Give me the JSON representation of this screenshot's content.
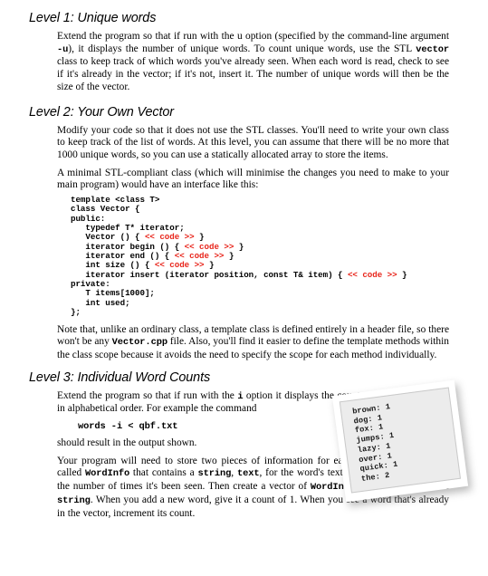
{
  "document": {
    "sections": [
      {
        "id": "level1",
        "heading": "Level 1: Unique words",
        "paragraphs": [
          "Extend the program so that if run with the |b:u| option (specified by the command-line argument |m:-u|), it displays the number of unique words.  To count unique words, use the STL |m:vector| class to keep track of which words you've already seen.  When each word is read, check to see if it's already in the vector; if it's not, insert it.  The number of unique words will then be the size of the vector."
        ]
      },
      {
        "id": "level2",
        "heading": "Level 2: Your Own Vector",
        "paragraphs": [
          "Modify your code so that it does not use the STL classes.  You'll need to write your own class to keep track of the list of words.  At this level, you can assume that there will be no more that 1000 unique words, so you can use a statically allocated array to store the items.",
          "A minimal STL-compliant class (which will minimise the changes you need to make to your main program) would have an interface like this:"
        ],
        "code_lines": [
          [
            {
              "t": "template <class T>",
              "c": "plain"
            }
          ],
          [
            {
              "t": "class Vector {",
              "c": "plain"
            }
          ],
          [
            {
              "t": "public:",
              "c": "plain"
            }
          ],
          [
            {
              "t": "   typedef T* iterator;",
              "c": "plain"
            }
          ],
          [
            {
              "t": "   Vector () { ",
              "c": "plain"
            },
            {
              "t": "<< code >>",
              "c": "ph"
            },
            {
              "t": " }",
              "c": "plain"
            }
          ],
          [
            {
              "t": "   iterator begin () { ",
              "c": "plain"
            },
            {
              "t": "<< code >>",
              "c": "ph"
            },
            {
              "t": " }",
              "c": "plain"
            }
          ],
          [
            {
              "t": "   iterator end () { ",
              "c": "plain"
            },
            {
              "t": "<< code >>",
              "c": "ph"
            },
            {
              "t": " }",
              "c": "plain"
            }
          ],
          [
            {
              "t": "   int size () { ",
              "c": "plain"
            },
            {
              "t": "<< code >>",
              "c": "ph"
            },
            {
              "t": " }",
              "c": "plain"
            }
          ],
          [
            {
              "t": "   iterator insert (iterator position, const T& item) { ",
              "c": "plain"
            },
            {
              "t": "<< code >>",
              "c": "ph"
            },
            {
              "t": " }",
              "c": "plain"
            }
          ],
          [
            {
              "t": "private:",
              "c": "plain"
            }
          ],
          [
            {
              "t": "   T items[1000];",
              "c": "plain"
            }
          ],
          [
            {
              "t": "   int used;",
              "c": "plain"
            }
          ],
          [
            {
              "t": "};",
              "c": "plain"
            }
          ]
        ],
        "after_code_paragraphs": [
          "Note that, unlike an ordinary class, a template class is defined entirely in a header file, so there won't be any |m:Vector.cpp| file.  Also, you'll find it easier to define the template methods within the class scope because it avoids the need to specify the scope for each method individually."
        ]
      },
      {
        "id": "level3",
        "heading": "Level 3: Individual Word Counts",
        "paragraphs_narrow": [
          "Extend the program so that if run with the |m:i| option it displays the counts of individual words in alphabetical order.  For example the command"
        ],
        "command": "words -i < qbf.txt",
        "paragraphs_after_command": [
          "should result in the output shown."
        ],
        "paragraphs_wrap": [
          "Your program will need to store two pieces of information for each word.  Define a struct called |m:WordInfo| that contains a |m:string|, |m:text|, for the word's text, and an |m:int|, |m:count|, for the number of times it's been seen.  Then create a vector of |m:WordInfo| instead of a vector of |m:string|.  When you add a new word, give it a count of 1. When you see a word that's already in the vector, increment its count."
        ]
      }
    ]
  },
  "output_card": {
    "label": "word-count-output",
    "lines": [
      "brown: 1",
      "dog: 1",
      "fox: 1",
      "jumps: 1",
      "lazy: 1",
      "over: 1",
      "quick: 1",
      "the: 2"
    ]
  },
  "colors": {
    "placeholder_red": "#e8251b",
    "card_paper": "#ffffff",
    "card_inner": "#ececec",
    "text": "#000000"
  }
}
